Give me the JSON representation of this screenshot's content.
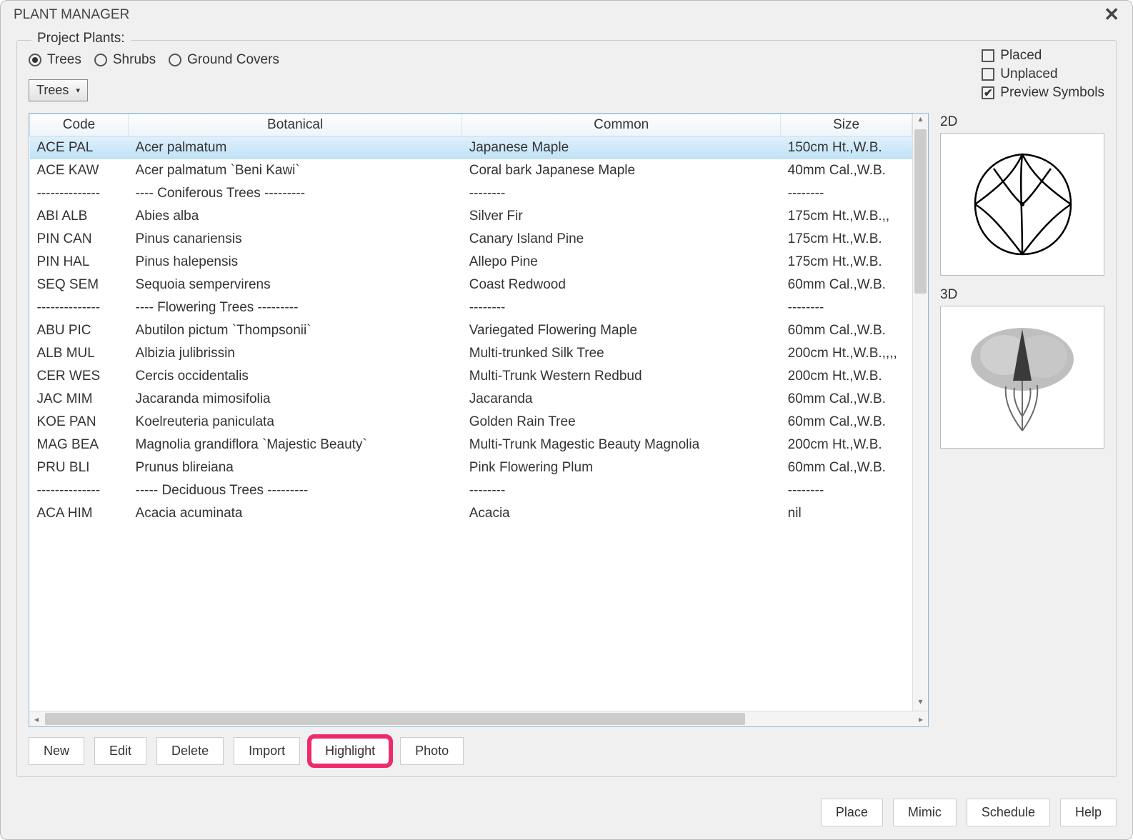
{
  "window_title": "PLANT MANAGER",
  "group_label": "Project Plants:",
  "radios": {
    "trees": "Trees",
    "shrubs": "Shrubs",
    "ground_covers": "Ground Covers",
    "selected": "trees"
  },
  "checks": {
    "placed": "Placed",
    "unplaced": "Unplaced",
    "preview_symbols": "Preview Symbols"
  },
  "dropdown_value": "Trees",
  "columns": {
    "code": "Code",
    "botanical": "Botanical",
    "common": "Common",
    "size": "Size"
  },
  "rows": [
    {
      "code": "ACE PAL",
      "botanical": "Acer palmatum",
      "common": "Japanese Maple",
      "size": "150cm Ht.,W.B.",
      "selected": true
    },
    {
      "code": "ACE KAW",
      "botanical": "Acer palmatum `Beni Kawi`",
      "common": "Coral bark Japanese Maple",
      "size": "40mm Cal.,W.B."
    },
    {
      "code": "--------------",
      "botanical": "---- Coniferous Trees ---------",
      "common": "--------",
      "size": "--------"
    },
    {
      "code": "ABI ALB",
      "botanical": "Abies alba",
      "common": "Silver Fir",
      "size": "175cm Ht.,W.B.,,"
    },
    {
      "code": "PIN CAN",
      "botanical": "Pinus canariensis",
      "common": "Canary Island Pine",
      "size": "175cm Ht.,W.B."
    },
    {
      "code": "PIN HAL",
      "botanical": "Pinus halepensis",
      "common": "Allepo Pine",
      "size": "175cm Ht.,W.B."
    },
    {
      "code": "SEQ SEM",
      "botanical": "Sequoia sempervirens",
      "common": "Coast Redwood",
      "size": "60mm Cal.,W.B."
    },
    {
      "code": "--------------",
      "botanical": "---- Flowering Trees ---------",
      "common": "--------",
      "size": "--------"
    },
    {
      "code": "ABU PIC",
      "botanical": "Abutilon pictum `Thompsonii`",
      "common": "Variegated Flowering Maple",
      "size": "60mm Cal.,W.B."
    },
    {
      "code": "ALB MUL",
      "botanical": "Albizia julibrissin",
      "common": "Multi-trunked Silk Tree",
      "size": "200cm Ht.,W.B.,,,,"
    },
    {
      "code": "CER WES",
      "botanical": "Cercis occidentalis",
      "common": "Multi-Trunk Western Redbud",
      "size": "200cm Ht.,W.B."
    },
    {
      "code": "JAC MIM",
      "botanical": "Jacaranda mimosifolia",
      "common": "Jacaranda",
      "size": "60mm Cal.,W.B."
    },
    {
      "code": "KOE PAN",
      "botanical": "Koelreuteria paniculata",
      "common": "Golden Rain Tree",
      "size": "60mm Cal.,W.B."
    },
    {
      "code": "MAG BEA",
      "botanical": "Magnolia grandiflora `Majestic Beauty`",
      "common": "Multi-Trunk Magestic Beauty Magnolia",
      "size": "200cm Ht.,W.B."
    },
    {
      "code": "PRU BLI",
      "botanical": "Prunus blireiana",
      "common": "Pink Flowering Plum",
      "size": "60mm Cal.,W.B."
    },
    {
      "code": "--------------",
      "botanical": "----- Deciduous Trees ---------",
      "common": "--------",
      "size": "--------"
    },
    {
      "code": "ACA HIM",
      "botanical": "Acacia acuminata",
      "common": "Acacia",
      "size": "nil"
    }
  ],
  "preview": {
    "label_2d": "2D",
    "label_3d": "3D"
  },
  "buttons_left": {
    "new": "New",
    "edit": "Edit",
    "delete": "Delete",
    "import": "Import",
    "highlight": "Highlight",
    "photo": "Photo"
  },
  "buttons_right": {
    "place": "Place",
    "mimic": "Mimic",
    "schedule": "Schedule",
    "help": "Help"
  }
}
